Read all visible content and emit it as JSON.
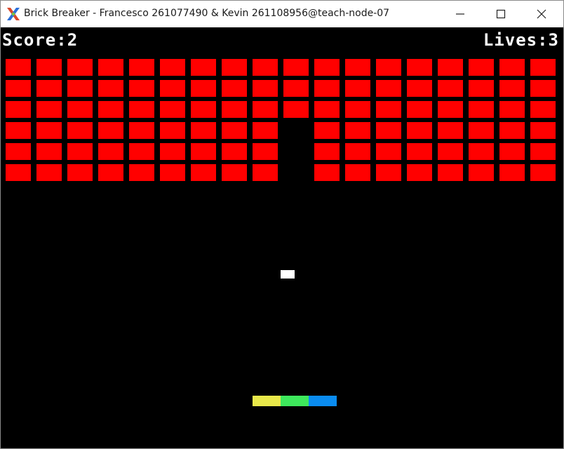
{
  "window": {
    "title": "Brick Breaker - Francesco 261077490 & Kevin 261108956@teach-node-07",
    "icon": "x-window-system-icon"
  },
  "hud": {
    "score_label": "Score:",
    "score_value": "2",
    "lives_label": "Lives:",
    "lives_value": "3"
  },
  "colors": {
    "background": "#000000",
    "brick": "#ff0000",
    "ball": "#ffffff",
    "paddle": [
      "#e8e84a",
      "#3ee85c",
      "#0a8cf0"
    ]
  },
  "bricks": {
    "rows": 6,
    "cols": 18,
    "missing": [
      [
        3,
        9
      ],
      [
        4,
        9
      ],
      [
        5,
        9
      ]
    ]
  }
}
